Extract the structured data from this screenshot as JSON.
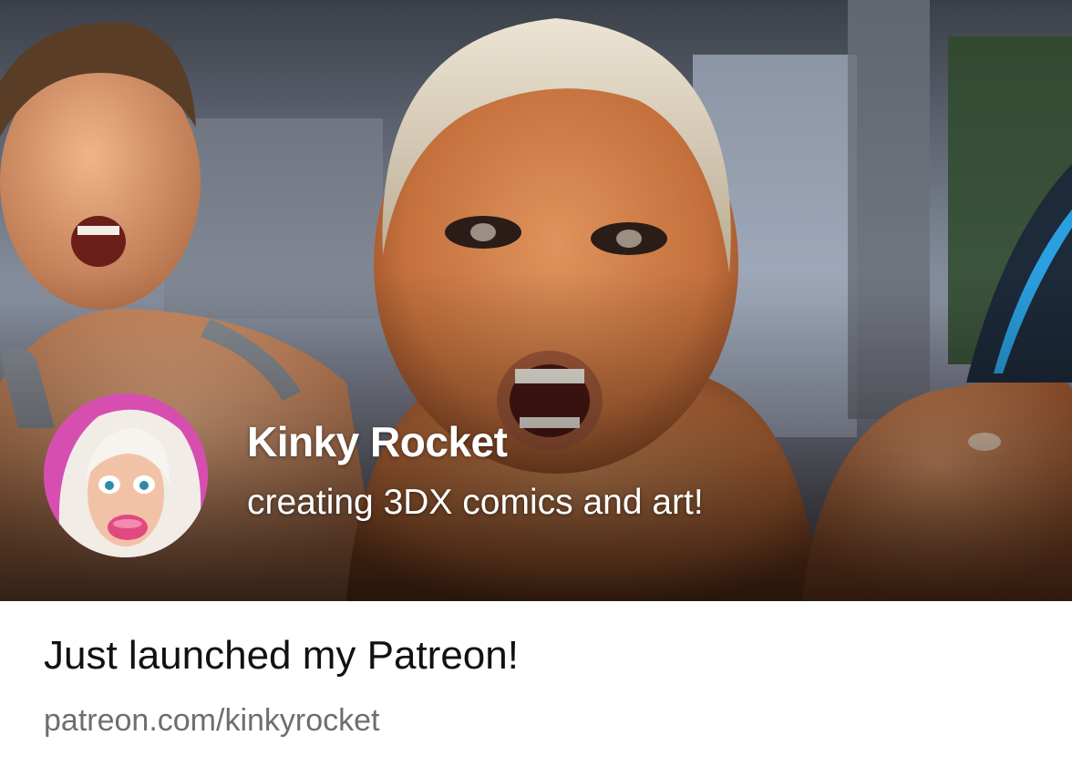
{
  "card": {
    "title": "Just launched my Patreon!",
    "url": "patreon.com/kinkyrocket"
  },
  "creator": {
    "name": "Kinky Rocket",
    "tagline": "creating 3DX comics and art!"
  },
  "images": {
    "banner": "banner-image",
    "avatar": "avatar-image"
  },
  "colors": {
    "title_text": "#111111",
    "url_text": "#6e6e6e",
    "overlay_text": "#ffffff",
    "avatar_bg": "#d64fb0"
  }
}
